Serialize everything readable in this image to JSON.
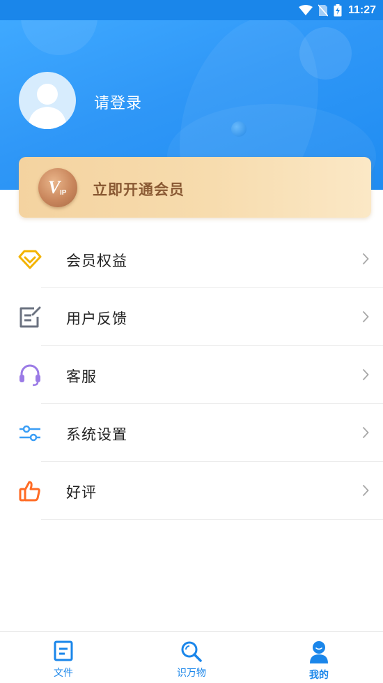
{
  "status_bar": {
    "time": "11:27"
  },
  "header": {
    "login_text": "请登录"
  },
  "vip": {
    "badge_text": "V",
    "badge_sub": "IP",
    "cta": "立即开通会员"
  },
  "menu": {
    "items": [
      {
        "label": "会员权益",
        "icon": "diamond-icon",
        "color": "#f3b300"
      },
      {
        "label": "用户反馈",
        "icon": "feedback-icon",
        "color": "#6b7280"
      },
      {
        "label": "客服",
        "icon": "headset-icon",
        "color": "#9b7be6"
      },
      {
        "label": "系统设置",
        "icon": "sliders-icon",
        "color": "#3b9ef5"
      },
      {
        "label": "好评",
        "icon": "thumbs-up-icon",
        "color": "#ff6b24"
      }
    ]
  },
  "bottom_nav": {
    "tabs": [
      {
        "label": "文件",
        "icon": "document-icon"
      },
      {
        "label": "识万物",
        "icon": "search-icon"
      },
      {
        "label": "我的",
        "icon": "user-icon",
        "active": true
      }
    ]
  },
  "colors": {
    "primary": "#1a86ea",
    "vip_text": "#8a5a34"
  }
}
